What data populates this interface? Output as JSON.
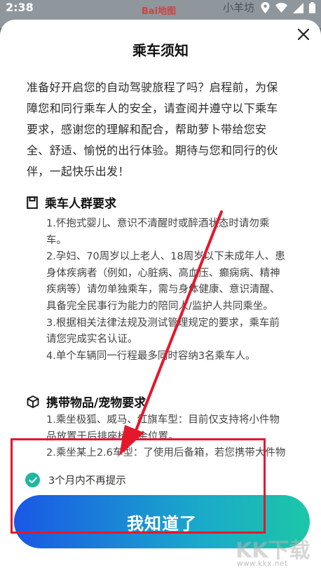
{
  "status_bar": {
    "time": "2:38",
    "icons": [
      "location-icon",
      "wifi-icon",
      "signal-icon",
      "battery-icon"
    ]
  },
  "map_background": {
    "place_label": "小羊坊",
    "logo_text": "Bai地图"
  },
  "dialog": {
    "title": "乘车须知",
    "intro_lines": [
      "准备好开启您的自动驾驶旅程了吗？启程前，为保",
      "障您和同行乘车人的安全，请查阅并遵守以下乘车",
      "要求，感谢您的理解和配合，帮助萝卜带给您安",
      "全、舒适、愉悦的出行体验。期待与您和同行的伙",
      "伴，一起快乐出发！"
    ],
    "sections": [
      {
        "heading": "乘车人群要求",
        "icon": "clipboard-icon",
        "lines": [
          "1.怀抱式婴儿、意识不清醒时或醉酒状态时请勿乘",
          "车。",
          "2.孕妇、70周岁以上老人、18周岁以下未成年人、患",
          "身体疾病者（例如，心脏病、高血压、癫痫病、精神",
          "疾病等）请勿单独乘车，需与身体健康、意识清醒、",
          "具备完全民事行为能力的陪同人/监护人共同乘坐。",
          "3.根据相关法律法规及测试管理规定的要求，乘车前",
          "请您完成实名认证。",
          "4.单个车辆同一行程最多同时容纳3名乘车人。"
        ]
      },
      {
        "heading": "携带物品/宠物要求",
        "icon": "package-icon",
        "lines": [
          "1.乘坐极狐、威马、红旗车型：目前仅支持将小件物",
          "品放置于后排座椅空余位置。",
          "2.乘坐某上2.6车型：了使用后备箱，若您携带大件物"
        ]
      }
    ],
    "checkbox_label": "3个月内不再提示",
    "checkbox_checked": true,
    "confirm_button": "我知道了"
  },
  "watermark": {
    "logo": "KK下载",
    "url": "www.kkx.net"
  },
  "colors": {
    "button_gradient_start": "#1a57e6",
    "button_gradient_end": "#1cc6a8",
    "check_color": "#1fb8a0",
    "annotation_red": "#e3182b"
  }
}
